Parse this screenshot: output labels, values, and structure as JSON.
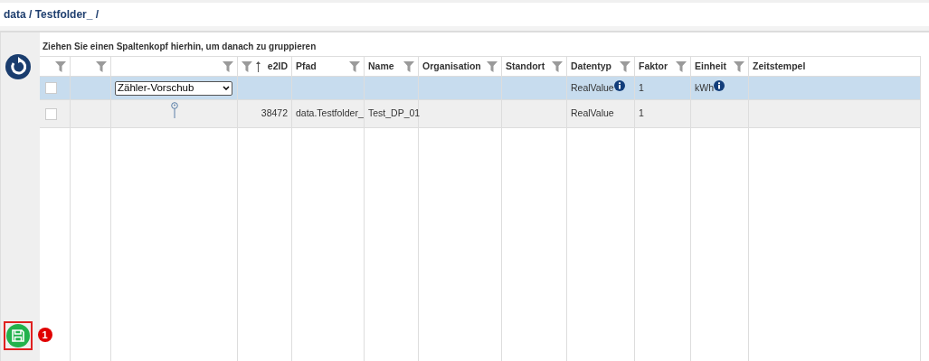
{
  "breadcrumb": "data / Testfolder_ /",
  "group_panel": "Ziehen Sie einen Spaltenkopf hierhin, um danach zu gruppieren",
  "columns": [
    {
      "filter": true
    },
    {
      "filter": true
    },
    {
      "filter": true
    },
    {
      "label": "e2ID",
      "filter": true,
      "sorted": true
    },
    {
      "label": "Pfad",
      "filter": true
    },
    {
      "label": "Name",
      "filter": true
    },
    {
      "label": "Organisation",
      "filter": true
    },
    {
      "label": "Standort",
      "filter": true
    },
    {
      "label": "Datentyp",
      "filter": true
    },
    {
      "label": "Faktor",
      "filter": true
    },
    {
      "label": "Einheit",
      "filter": true
    },
    {
      "label": "Zeitstempel",
      "filter": false
    }
  ],
  "rows": [
    {
      "selected": true,
      "cells": [
        {
          "kind": "checkbox",
          "checked": false
        },
        {
          "kind": "empty"
        },
        {
          "kind": "select",
          "value": "Zähler-Vorschub"
        },
        {
          "kind": "empty"
        },
        {
          "kind": "empty"
        },
        {
          "kind": "empty"
        },
        {
          "kind": "empty"
        },
        {
          "kind": "empty"
        },
        {
          "kind": "text",
          "text": "RealValue",
          "info": true
        },
        {
          "kind": "text",
          "text": "1"
        },
        {
          "kind": "text",
          "text": "kWh",
          "info": true
        },
        {
          "kind": "empty"
        }
      ]
    },
    {
      "selected": false,
      "cells": [
        {
          "kind": "checkbox",
          "checked": false
        },
        {
          "kind": "empty"
        },
        {
          "kind": "pin"
        },
        {
          "kind": "text",
          "text": "38472"
        },
        {
          "kind": "text",
          "text": "data.Testfolder_"
        },
        {
          "kind": "text",
          "text": "Test_DP_01"
        },
        {
          "kind": "empty"
        },
        {
          "kind": "empty"
        },
        {
          "kind": "text",
          "text": "RealValue"
        },
        {
          "kind": "text",
          "text": "1"
        },
        {
          "kind": "empty"
        },
        {
          "kind": "empty"
        }
      ]
    }
  ],
  "save_badge": "1"
}
